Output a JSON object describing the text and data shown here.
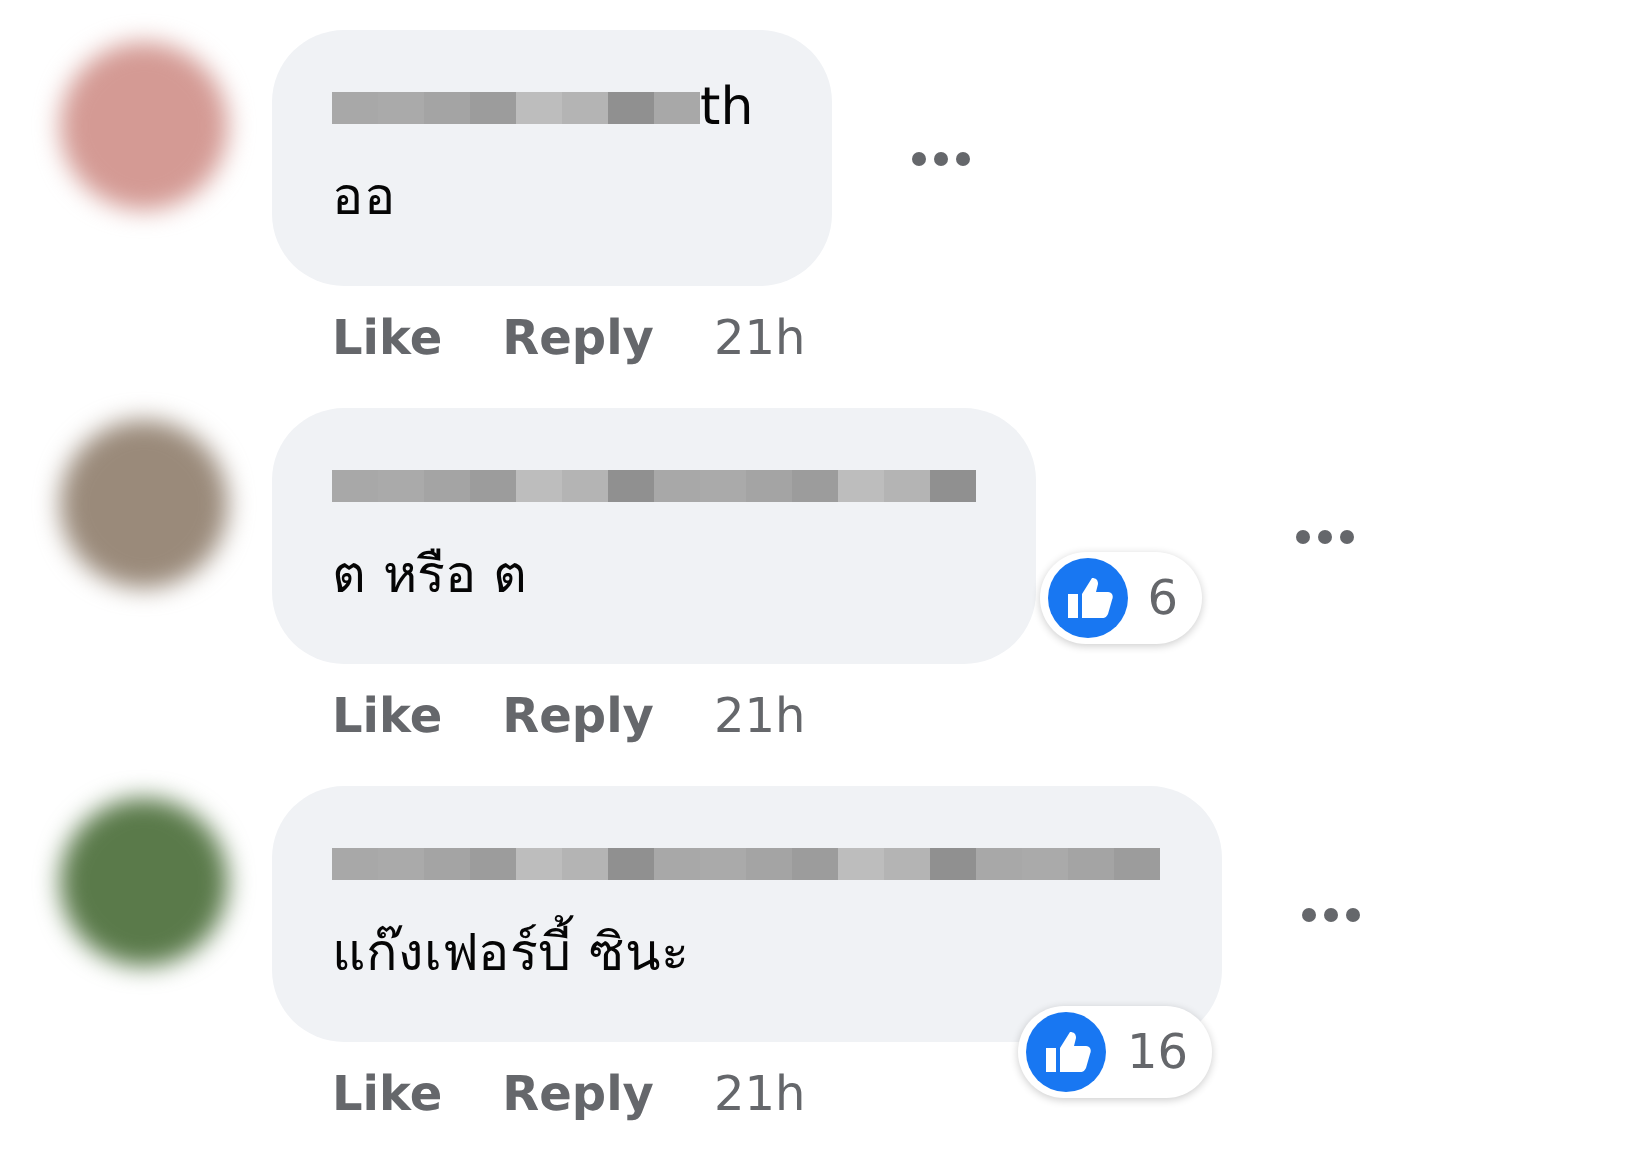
{
  "comments": [
    {
      "author": "th",
      "name_redacted": true,
      "text": "ออ",
      "actions": [
        "Like",
        "Reply"
      ],
      "time": "21h"
    },
    {
      "name_redacted": true,
      "text": "ต หรือ ต",
      "reactions": "6",
      "actions": [
        "Like",
        "Reply"
      ],
      "time": "21h"
    },
    {
      "name_redacted": true,
      "text": "แก๊งเฟอร์บี้ ซินะ",
      "reactions": "16",
      "actions": [
        "Like",
        "Reply"
      ],
      "time": "21h"
    }
  ]
}
